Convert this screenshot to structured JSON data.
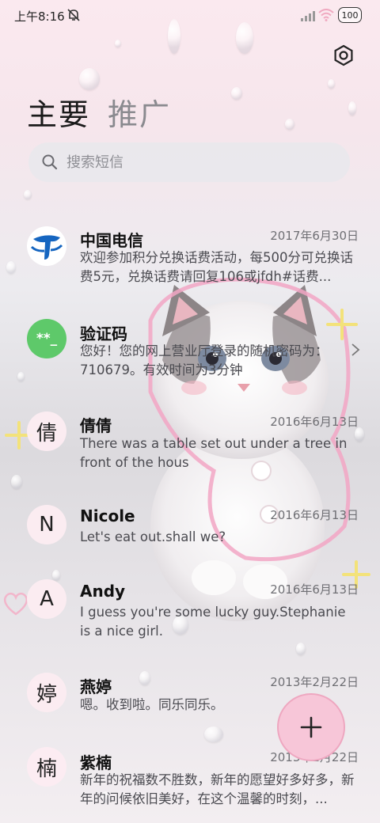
{
  "status_bar": {
    "time": "上午8:16",
    "battery": "100"
  },
  "header": {
    "tabs": [
      {
        "label": "主要",
        "active": true
      },
      {
        "label": "推广",
        "active": false
      }
    ]
  },
  "search": {
    "placeholder": "搜索短信"
  },
  "messages": [
    {
      "avatar": "",
      "avatar_icon": "china-telecom-logo",
      "name": "中国电信",
      "date": "2017年6月30日",
      "preview": "欢迎参加积分兑换话费活动，每500分可兑换话费5元，兑换话费请回复106或jfdh#话费..."
    },
    {
      "avatar": "**_",
      "name": "验证码",
      "date": "",
      "preview": "您好！您的网上营业厅登录的随机密码为：710679。有效时间为3分钟"
    },
    {
      "avatar": "倩",
      "name": "倩倩",
      "date": "2016年6月13日",
      "preview": "There was a table set out under a tree in front of the hous"
    },
    {
      "avatar": "N",
      "name": "Nicole",
      "date": "2016年6月13日",
      "preview": "Let's eat out.shall we?"
    },
    {
      "avatar": "A",
      "name": "Andy",
      "date": "2016年6月13日",
      "preview": "I guess you're some lucky guy.Stephanie is a nice girl."
    },
    {
      "avatar": "婷",
      "name": "燕婷",
      "date": "2013年2月22日",
      "preview": "嗯。收到啦。同乐同乐。"
    },
    {
      "avatar": "楠",
      "name": "紫楠",
      "date": "2013年2月22日",
      "preview": "新年的祝福数不胜数，新年的愿望好多好多，新年的问候依旧美好，在这个温馨的时刻，..."
    }
  ],
  "colors": {
    "accent": "#f7c6d8",
    "code_avatar": "#5ec96a",
    "telecom_blue": "#1565c0"
  }
}
